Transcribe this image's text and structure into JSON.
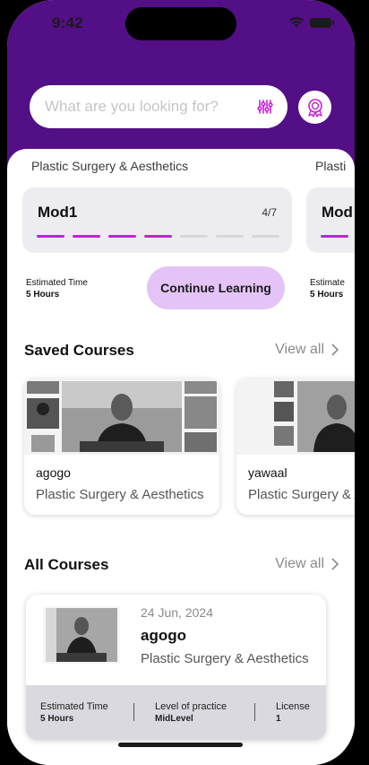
{
  "status": {
    "time": "9:42"
  },
  "search": {
    "placeholder": "What are you looking for?"
  },
  "icons": {
    "filter": "sliders-icon",
    "award": "award-ribbon-icon",
    "chevron": "chevron-right-icon"
  },
  "colors": {
    "header": "#530f85",
    "accent": "#c61fd9",
    "continue_button": "#e4c3f6"
  },
  "current_courses": [
    {
      "category": "Plastic Surgery & Aesthetics",
      "module": "Mod1",
      "progress_text": "4/7",
      "progress": {
        "completed": 4,
        "total": 7
      },
      "est_label": "Estimated Time",
      "est_value": "5 Hours",
      "continue_label": "Continue Learning"
    },
    {
      "category": "Plasti",
      "module": "Mod",
      "est_label": "Estimate",
      "est_value": "5 Hours"
    }
  ],
  "saved": {
    "title": "Saved Courses",
    "view_all": "View all",
    "items": [
      {
        "name": "agogo",
        "category": "Plastic Surgery & Aesthetics"
      },
      {
        "name": "yawaal",
        "category": "Plastic Surgery & Aesthetics"
      }
    ]
  },
  "all_courses": {
    "title": "All Courses",
    "view_all": "View all",
    "items": [
      {
        "date": "24 Jun, 2024",
        "name": "agogo",
        "category": "Plastic Surgery & Aesthetics",
        "est_label": "Estimated Time",
        "est_value": "5 Hours",
        "level_label": "Level of practice",
        "level_value": "MidLevel",
        "license_label": "License",
        "license_value": "1"
      }
    ]
  }
}
